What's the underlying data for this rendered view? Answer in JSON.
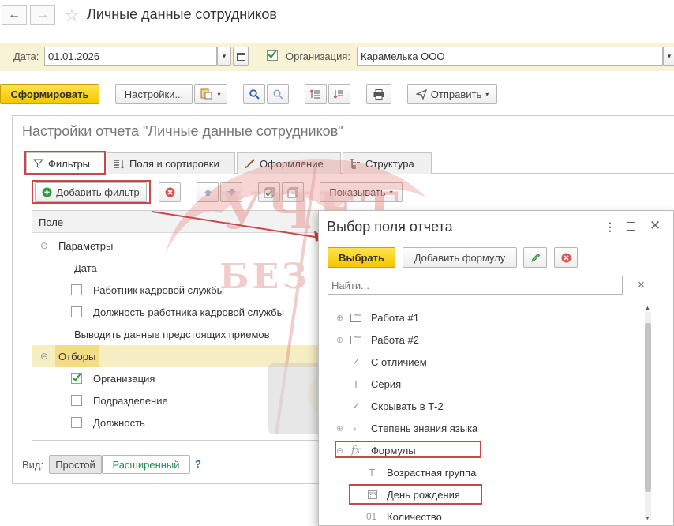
{
  "header": {
    "back_icon": "arrow-left-icon",
    "forward_icon": "arrow-right-icon",
    "favorite_icon": "star-icon",
    "title": "Личные данные сотрудников"
  },
  "params": {
    "date_label": "Дата:",
    "date_value": "01.01.2026",
    "org_label": "Организация:",
    "org_value": "Карамелька ООО",
    "org_checked": true
  },
  "toolbar": {
    "generate": "Сформировать",
    "settings": "Настройки...",
    "send": "Отправить"
  },
  "settings": {
    "title": "Настройки отчета \"Личные данные сотрудников\"",
    "tabs": [
      {
        "label": "Фильтры",
        "icon": "funnel-icon"
      },
      {
        "label": "Поля и сортировки",
        "icon": "columns-icon"
      },
      {
        "label": "Оформление",
        "icon": "brush-icon"
      },
      {
        "label": "Структура",
        "icon": "structure-icon"
      }
    ],
    "add_filter": "Добавить фильтр",
    "show": "Показывать",
    "column_header": "Поле",
    "tree": {
      "params_group": "Параметры",
      "date": "Дата",
      "hr_worker": "Работник кадровой службы",
      "hr_position": "Должность работника кадровой службы",
      "prev_hires": "Выводить данные предстоящих приемов",
      "selections_group": "Отборы",
      "organization": "Организация",
      "department": "Подразделение",
      "position": "Должность"
    },
    "view_label": "Вид:",
    "view_simple": "Простой",
    "view_extended": "Расширенный",
    "help": "?"
  },
  "dialog": {
    "title": "Выбор поля отчета",
    "select": "Выбрать",
    "add_formula": "Добавить формулу",
    "search_placeholder": "Найти...",
    "clear": "×",
    "items": {
      "work1": "Работа #1",
      "work2": "Работа #2",
      "honors": "С отличием",
      "series": "Серия",
      "hide_t2": "Скрывать в Т-2",
      "language": "Степень знания языка",
      "formulas": "Формулы",
      "age_group": "Возрастная группа",
      "birthday": "День рождения",
      "quantity": "Количество"
    },
    "quantity_prefix": "01",
    "fx_prefix": "fx",
    "text_prefix": "T"
  },
  "watermark": {
    "line1": "УЧЕТ",
    "line2": "БЕЗ ЗАБОТ"
  },
  "colors": {
    "accent_yellow": "#f4c600",
    "highlight_box": "#c9474a",
    "selected_row": "#f7edc3",
    "green_check": "#2e9b3e",
    "red_icon": "#d9534f"
  }
}
